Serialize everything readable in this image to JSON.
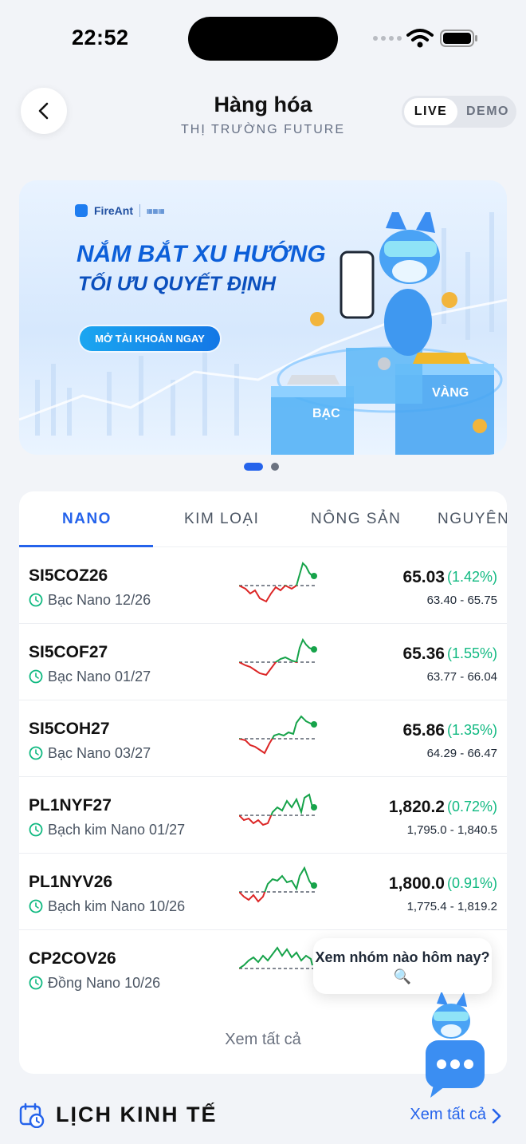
{
  "status_bar": {
    "time": "22:52"
  },
  "header": {
    "title": "Hàng hóa",
    "subtitle": "THỊ TRƯỜNG FUTURE",
    "mode_live": "LIVE",
    "mode_demo": "DEMO",
    "active_mode": "LIVE"
  },
  "banner": {
    "brand": "FireAnt",
    "headline_1": "NẮM BẮT XU HƯỚNG",
    "headline_2": "TỐI ƯU QUYẾT ĐỊNH",
    "cta": "MỞ TÀI KHOẢN NGAY",
    "label_silver": "BẠC",
    "label_gold": "VÀNG",
    "page_index": 1,
    "page_count": 2
  },
  "tabs": [
    "NANO",
    "KIM LOẠI",
    "NÔNG SẢN",
    "NGUYÊN"
  ],
  "active_tab": "NANO",
  "rows": [
    {
      "symbol": "SI5COZ26",
      "name": "Bạc Nano 12/26",
      "price": "65.03",
      "change": "(1.42%)",
      "range": "63.40 - 65.75"
    },
    {
      "symbol": "SI5COF27",
      "name": "Bạc Nano 01/27",
      "price": "65.36",
      "change": "(1.55%)",
      "range": "63.77 - 66.04"
    },
    {
      "symbol": "SI5COH27",
      "name": "Bạc Nano 03/27",
      "price": "65.86",
      "change": "(1.35%)",
      "range": "64.29 - 66.47"
    },
    {
      "symbol": "PL1NYF27",
      "name": "Bạch kim Nano 01/27",
      "price": "1,820.2",
      "change": "(0.72%)",
      "range": "1,795.0 - 1,840.5"
    },
    {
      "symbol": "PL1NYV26",
      "name": "Bạch kim Nano 10/26",
      "price": "1,800.0",
      "change": "(0.91%)",
      "range": "1,775.4 - 1,819.2"
    },
    {
      "symbol": "CP2COV26",
      "name": "Đồng Nano 10/26",
      "price": "",
      "change": "",
      "range": ""
    }
  ],
  "see_all": "Xem tất cả",
  "assistant_bubble": "Xem nhóm nào hôm nay? 🔍",
  "section": {
    "title": "LỊCH KINH TẾ",
    "link": "Xem tất cả"
  },
  "colors": {
    "accent": "#2563eb",
    "up": "#10b981",
    "down": "#dc2626",
    "spark_up": "#16a34a"
  },
  "icons": [
    "back-chevron-icon",
    "wifi-icon",
    "battery-icon",
    "clock-icon",
    "calendar-clock-icon",
    "chevron-right-icon",
    "chat-icon"
  ]
}
